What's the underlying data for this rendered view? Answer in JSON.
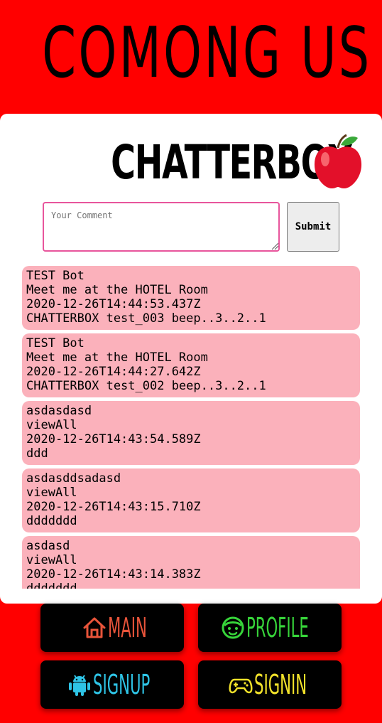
{
  "site": {
    "title": "COMONG US"
  },
  "panel": {
    "title": "CHATTERBOX",
    "title_icon": "apple-icon"
  },
  "comment": {
    "placeholder": "Your Comment",
    "value": ""
  },
  "submit": {
    "label": "Submit"
  },
  "messages": [
    {
      "name": "TEST Bot",
      "room": "Meet me at the HOTEL Room",
      "time": "2020-12-26T14:44:53.437Z",
      "text": "CHATTERBOX test_003 beep..3..2..1"
    },
    {
      "name": "TEST Bot",
      "room": "Meet me at the HOTEL Room",
      "time": "2020-12-26T14:44:27.642Z",
      "text": "CHATTERBOX test_002 beep..3..2..1"
    },
    {
      "name": "asdasdasd",
      "room": "viewAll",
      "time": "2020-12-26T14:43:54.589Z",
      "text": "ddd"
    },
    {
      "name": "asdasddsadasd",
      "room": "viewAll",
      "time": "2020-12-26T14:43:15.710Z",
      "text": "ddddddd"
    },
    {
      "name": "asdasd",
      "room": "viewAll",
      "time": "2020-12-26T14:43:14.383Z",
      "text": "ddddddd"
    }
  ],
  "nav": {
    "main": {
      "label": "MAIN",
      "icon": "home-icon",
      "color": "#e8543a"
    },
    "profile": {
      "label": "PROFILE",
      "icon": "smiley-icon",
      "color": "#37d43a"
    },
    "signup": {
      "label": "SIGNUP",
      "icon": "android-icon",
      "color": "#2ec4e6"
    },
    "signin": {
      "label": "SIGNIN",
      "icon": "gamepad-icon",
      "color": "#f2e22a"
    }
  },
  "colors": {
    "background": "#ff0000",
    "card": "#fbb1bb",
    "input_border": "#e8559c",
    "button_bg": "#000000"
  }
}
